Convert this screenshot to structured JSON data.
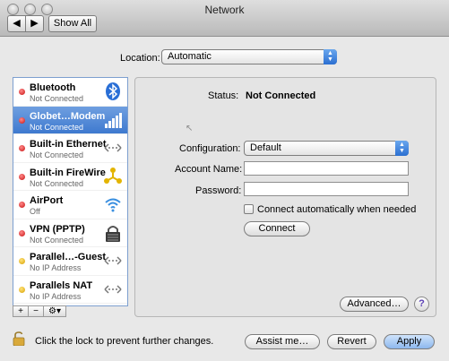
{
  "window": {
    "title": "Network",
    "show_all": "Show All",
    "nav_back": "◀",
    "nav_forward": "▶"
  },
  "location": {
    "label": "Location:",
    "value": "Automatic"
  },
  "services": [
    {
      "name": "Bluetooth",
      "status": "Not Connected",
      "dot": "red",
      "icon": "bluetooth-icon"
    },
    {
      "name": "Globet…Modem",
      "status": "Not Connected",
      "dot": "red",
      "icon": "signal-bars-icon",
      "selected": true
    },
    {
      "name": "Built-in Ethernet",
      "status": "Not Connected",
      "dot": "red",
      "icon": "ethernet-icon"
    },
    {
      "name": "Built-in FireWire",
      "status": "Not Connected",
      "dot": "red",
      "icon": "firewire-icon"
    },
    {
      "name": "AirPort",
      "status": "Off",
      "dot": "red",
      "icon": "airport-icon"
    },
    {
      "name": "VPN (PPTP)",
      "status": "Not Connected",
      "dot": "red",
      "icon": "vpn-lock-icon"
    },
    {
      "name": "Parallel…-Guest",
      "status": "No IP Address",
      "dot": "yellow",
      "icon": "ethernet-icon"
    },
    {
      "name": "Parallels NAT",
      "status": "No IP Address",
      "dot": "yellow",
      "icon": "ethernet-icon"
    }
  ],
  "list_tools": {
    "add": "+",
    "remove": "−",
    "action": "⚙▾"
  },
  "detail": {
    "status_label": "Status:",
    "status_value": "Not Connected",
    "configuration_label": "Configuration:",
    "configuration_value": "Default",
    "account_label": "Account Name:",
    "account_value": "",
    "password_label": "Password:",
    "password_value": "",
    "auto_connect_label": "Connect automatically when needed",
    "connect_button": "Connect",
    "advanced_button": "Advanced…",
    "help_button": "?"
  },
  "bottom": {
    "lock_text": "Click the lock to prevent further changes.",
    "assist_button": "Assist me…",
    "revert_button": "Revert",
    "apply_button": "Apply"
  },
  "colors": {
    "selection": "#3e79cf",
    "red_status": "#c81010",
    "yellow_status": "#d8a000",
    "default_button": "#8db8ee"
  }
}
